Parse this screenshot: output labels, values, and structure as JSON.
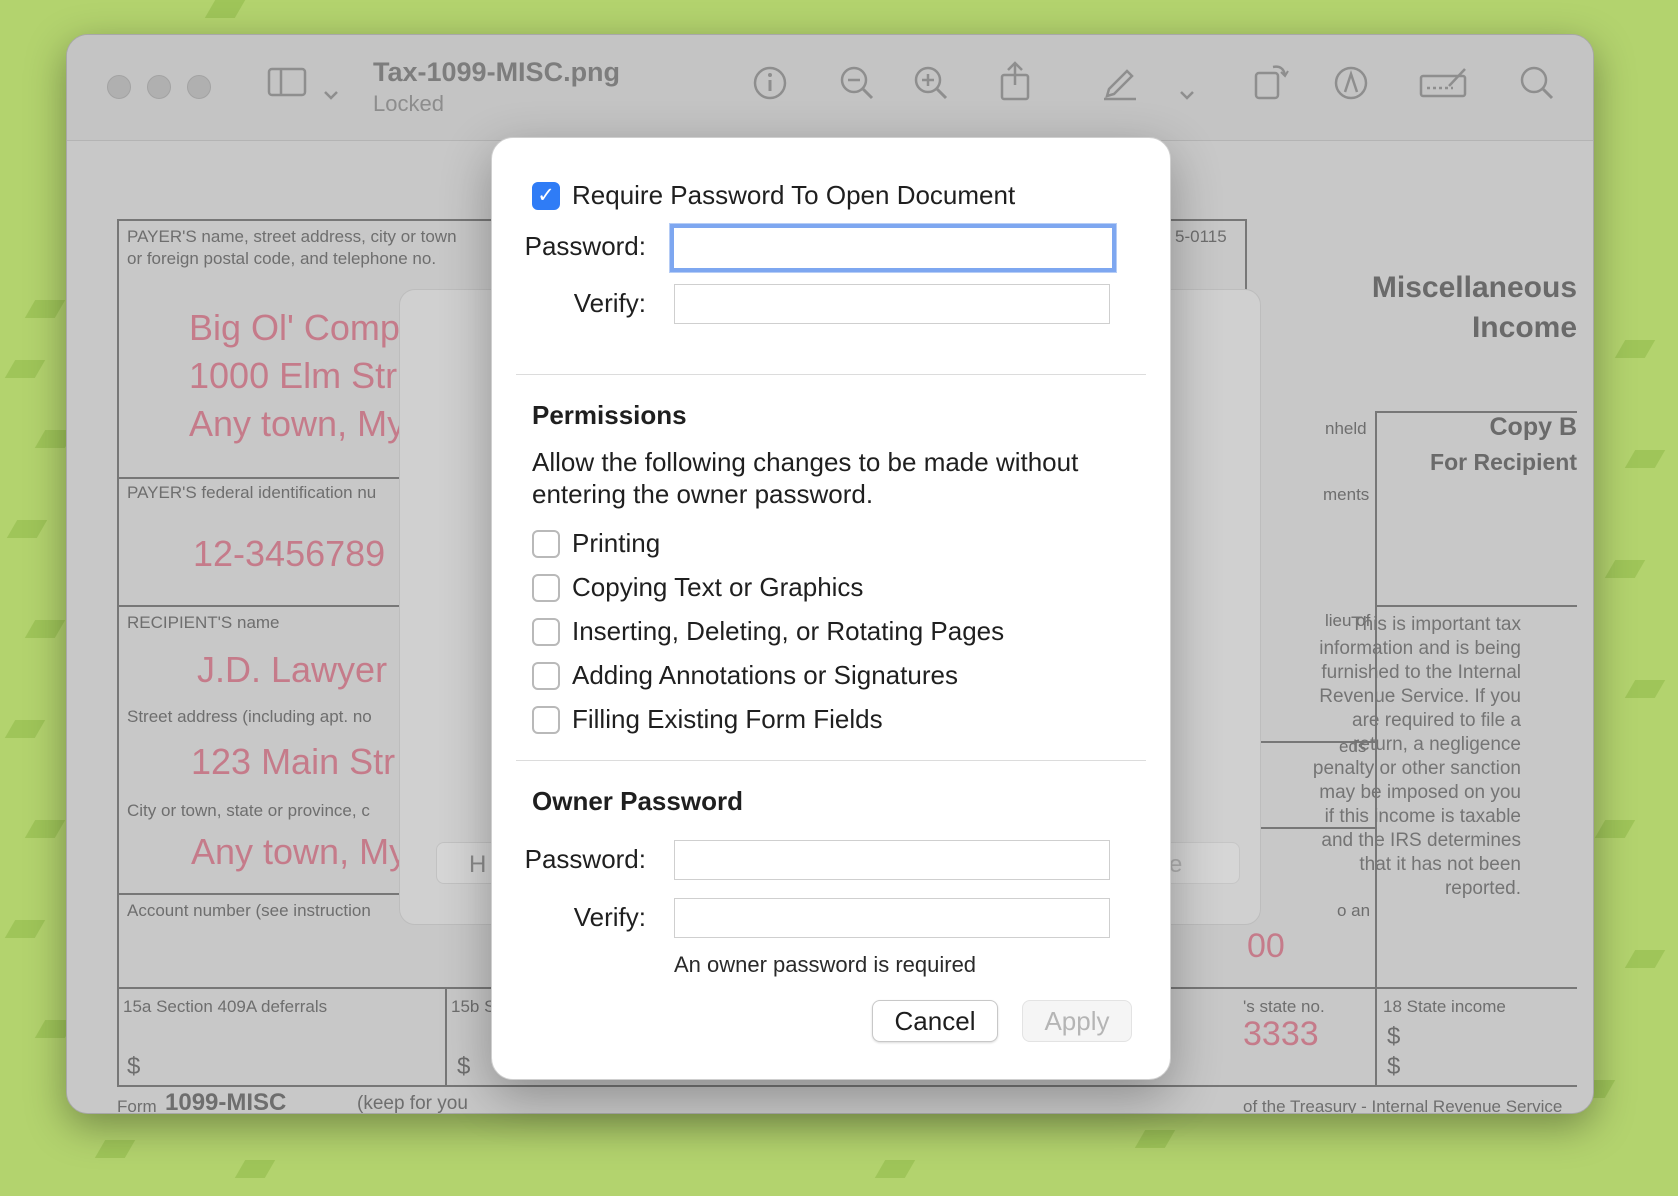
{
  "window": {
    "title": "Tax-1099-MISC.png",
    "subtitle": "Locked"
  },
  "form": {
    "payer_label": "PAYER'S name, street address, city or town",
    "payer_label2": "or foreign postal code, and telephone no.",
    "payer_name": "Big Ol' Comp",
    "payer_street": "1000 Elm Str",
    "payer_city": "Any town, My",
    "payer_tin_label": "PAYER'S federal identification nu",
    "payer_tin": "12-3456789",
    "recipient_label": "RECIPIENT'S name",
    "recipient_name": "J.D. Lawyer",
    "street_label": "Street address (including apt. no",
    "recipient_street": "123 Main Str",
    "city_label": "City or town, state or province, c",
    "recipient_city": "Any town, My",
    "account_label": "Account number (see instruction",
    "box15a": "15a Section 409A deferrals",
    "box15b": "15b S",
    "dollar": "$",
    "form_name_prefix": "Form",
    "form_name": "1099-MISC",
    "keep": "(keep for you",
    "omb": "5-0115",
    "misc_title_1": "Miscellaneous",
    "misc_title_2": "Income",
    "copy_b": "Copy B",
    "for_recipient": "For Recipient",
    "withheld": "nheld",
    "ments": "ments",
    "lieu": "lieu of",
    "eds": "eds",
    "o_an": "o an",
    "amount_00": "00",
    "state_no": "'s state no.",
    "state_val": "3333",
    "box18": "18 State income",
    "treasury": "of the Treasury - Internal Revenue Service",
    "notice": "This is important tax information and is being furnished to the Internal Revenue Service. If you are required to file a return, a negligence penalty or other sanction may be imposed on you if this income is taxable and the IRS determines that it has not been reported.",
    "sheet_btn_left": "H",
    "sheet_btn_right": "e"
  },
  "dialog": {
    "require_password_label": "Require Password To Open Document",
    "require_password_checked": true,
    "password_label": "Password:",
    "password_value": "",
    "verify_label": "Verify:",
    "verify_value": "",
    "permissions_heading": "Permissions",
    "permissions_desc": "Allow the following changes to be made without entering the owner password.",
    "permissions": [
      {
        "label": "Printing",
        "checked": false
      },
      {
        "label": "Copying Text or Graphics",
        "checked": false
      },
      {
        "label": "Inserting, Deleting, or Rotating Pages",
        "checked": false
      },
      {
        "label": "Adding Annotations or Signatures",
        "checked": false
      },
      {
        "label": "Filling Existing Form Fields",
        "checked": false
      }
    ],
    "owner_heading": "Owner Password",
    "owner_password_label": "Password:",
    "owner_verify_label": "Verify:",
    "owner_hint": "An owner password is required",
    "cancel_label": "Cancel",
    "apply_label": "Apply"
  },
  "colors": {
    "accent": "#2f7cf6",
    "background": "#b3d36e",
    "form_pink": "#c57b8a"
  }
}
